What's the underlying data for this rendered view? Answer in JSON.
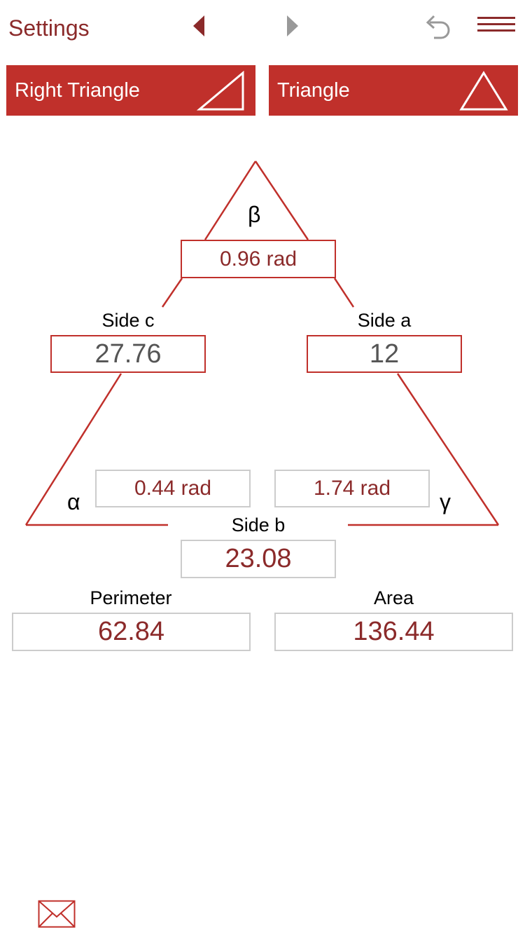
{
  "header": {
    "title": "Settings",
    "prev_icon": "triangle-left",
    "next_icon": "triangle-right",
    "undo_icon": "undo-arrow",
    "menu_icon": "hamburger-menu"
  },
  "tabs": [
    {
      "label": "Right Triangle",
      "icon": "right-triangle"
    },
    {
      "label": "Triangle",
      "icon": "triangle"
    }
  ],
  "angles": {
    "beta": {
      "symbol": "β",
      "value": "0.96 rad"
    },
    "alpha": {
      "symbol": "α",
      "value": "0.44 rad"
    },
    "gamma": {
      "symbol": "γ",
      "value": "1.74 rad"
    }
  },
  "sides": {
    "c": {
      "label": "Side c",
      "value": "27.76"
    },
    "a": {
      "label": "Side a",
      "value": "12"
    },
    "b": {
      "label": "Side b",
      "value": "23.08"
    }
  },
  "results": {
    "perimeter": {
      "label": "Perimeter",
      "value": "62.84"
    },
    "area": {
      "label": "Area",
      "value": "136.44"
    }
  },
  "footer": {
    "mail_icon": "envelope"
  },
  "colors": {
    "accent": "#c0302b",
    "value_text": "#8b2a2a",
    "input_text": "#555555",
    "border_gray": "#cccccc"
  }
}
